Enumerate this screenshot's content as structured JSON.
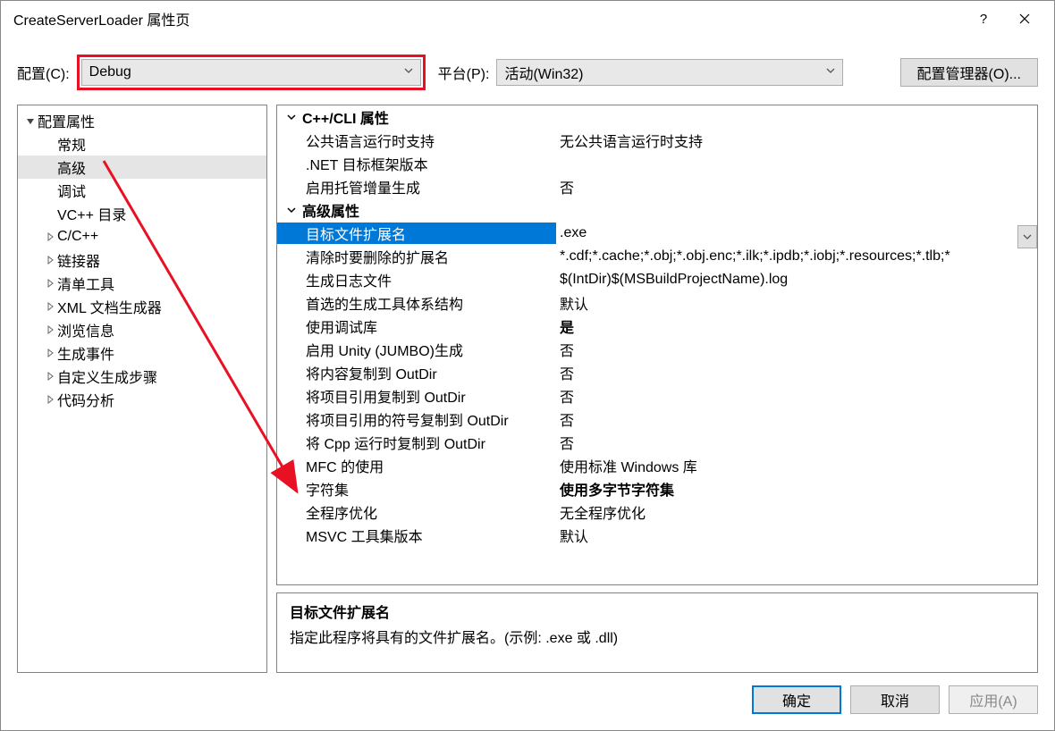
{
  "window": {
    "title": "CreateServerLoader 属性页"
  },
  "config": {
    "label": "配置(C):",
    "value": "Debug",
    "platform_label": "平台(P):",
    "platform_value": "活动(Win32)",
    "manager_button": "配置管理器(O)..."
  },
  "tree": {
    "root": "配置属性",
    "items": [
      {
        "label": "常规",
        "expandable": false
      },
      {
        "label": "高级",
        "expandable": false,
        "selected": true
      },
      {
        "label": "调试",
        "expandable": false
      },
      {
        "label": "VC++ 目录",
        "expandable": false
      },
      {
        "label": "C/C++",
        "expandable": true
      },
      {
        "label": "链接器",
        "expandable": true
      },
      {
        "label": "清单工具",
        "expandable": true
      },
      {
        "label": "XML 文档生成器",
        "expandable": true
      },
      {
        "label": "浏览信息",
        "expandable": true
      },
      {
        "label": "生成事件",
        "expandable": true
      },
      {
        "label": "自定义生成步骤",
        "expandable": true
      },
      {
        "label": "代码分析",
        "expandable": true
      }
    ]
  },
  "properties": {
    "categories": [
      {
        "name": "C++/CLI 属性",
        "props": [
          {
            "name": "公共语言运行时支持",
            "value": "无公共语言运行时支持"
          },
          {
            "name": ".NET 目标框架版本",
            "value": ""
          },
          {
            "name": "启用托管增量生成",
            "value": "否"
          }
        ]
      },
      {
        "name": "高级属性",
        "props": [
          {
            "name": "目标文件扩展名",
            "value": ".exe",
            "selected": true
          },
          {
            "name": "清除时要删除的扩展名",
            "value": "*.cdf;*.cache;*.obj;*.obj.enc;*.ilk;*.ipdb;*.iobj;*.resources;*.tlb;*"
          },
          {
            "name": "生成日志文件",
            "value": "$(IntDir)$(MSBuildProjectName).log"
          },
          {
            "name": "首选的生成工具体系结构",
            "value": "默认"
          },
          {
            "name": "使用调试库",
            "value": "是",
            "bold": true
          },
          {
            "name": "启用 Unity (JUMBO)生成",
            "value": "否"
          },
          {
            "name": "将内容复制到 OutDir",
            "value": "否"
          },
          {
            "name": "将项目引用复制到 OutDir",
            "value": "否"
          },
          {
            "name": "将项目引用的符号复制到 OutDir",
            "value": "否"
          },
          {
            "name": "将 Cpp 运行时复制到 OutDir",
            "value": "否"
          },
          {
            "name": "MFC 的使用",
            "value": "使用标准 Windows 库"
          },
          {
            "name": "字符集",
            "value": "使用多字节字符集",
            "bold": true
          },
          {
            "name": "全程序优化",
            "value": "无全程序优化"
          },
          {
            "name": "MSVC 工具集版本",
            "value": "默认"
          }
        ]
      }
    ]
  },
  "description": {
    "title": "目标文件扩展名",
    "text": "指定此程序将具有的文件扩展名。(示例: .exe 或 .dll)"
  },
  "buttons": {
    "ok": "确定",
    "cancel": "取消",
    "apply": "应用(A)"
  }
}
